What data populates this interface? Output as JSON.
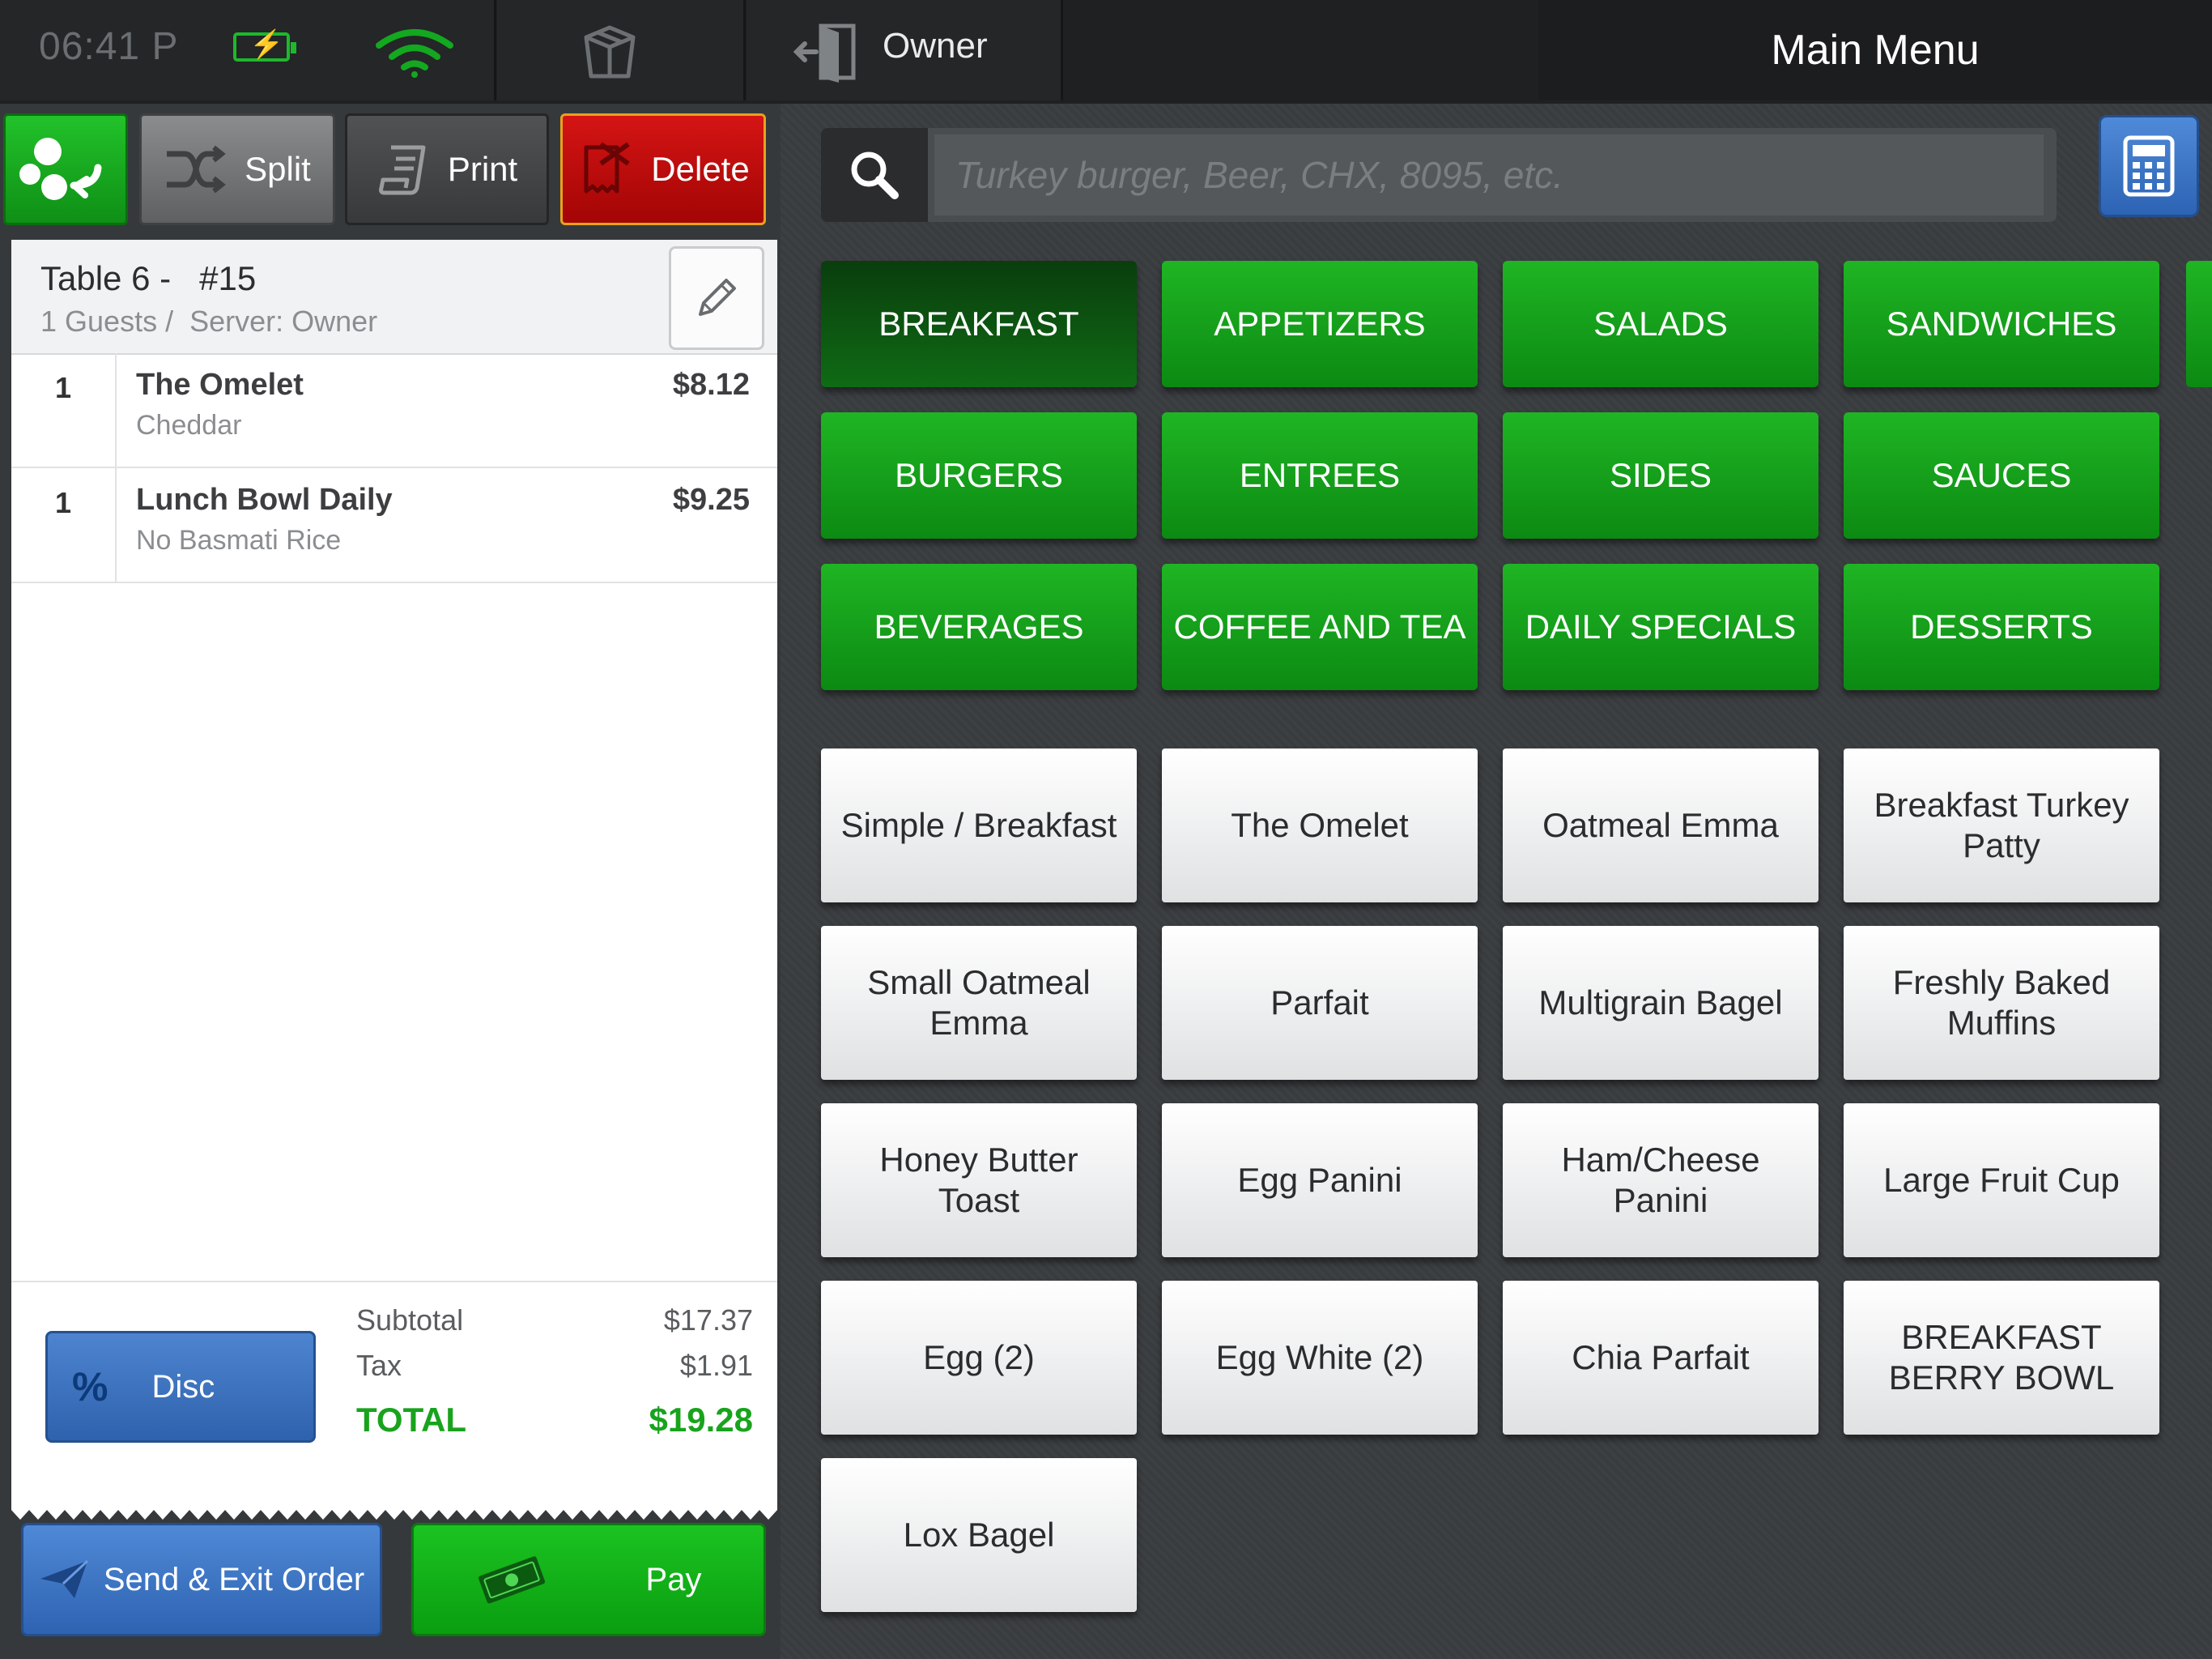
{
  "status_bar": {
    "time": "06:41 P",
    "user": "Owner",
    "title": "Main Menu"
  },
  "actions": {
    "split": "Split",
    "print": "Print",
    "delete": "Delete"
  },
  "ticket": {
    "table": "Table 6 -   #15",
    "subtitle": "1 Guests /  Server: Owner",
    "items": [
      {
        "qty": "1",
        "name": "The Omelet",
        "modifier": "Cheddar",
        "price": "$8.12"
      },
      {
        "qty": "1",
        "name": "Lunch Bowl Daily",
        "modifier": "No Basmati Rice",
        "price": "$9.25"
      }
    ],
    "subtotal_label": "Subtotal",
    "subtotal": "$17.37",
    "tax_label": "Tax",
    "tax": "$1.91",
    "total_label": "TOTAL",
    "total": "$19.28",
    "disc_symbol": "%",
    "disc_label": "Disc"
  },
  "bottom": {
    "send": "Send & Exit Order",
    "pay": "Pay"
  },
  "search": {
    "placeholder": "Turkey burger, Beer, CHX, 8095, etc."
  },
  "categories": [
    {
      "label": "BREAKFAST",
      "selected": true
    },
    {
      "label": "APPETIZERS"
    },
    {
      "label": "SALADS"
    },
    {
      "label": "SANDWICHES"
    },
    {
      "label": "BURGERS"
    },
    {
      "label": "ENTREES"
    },
    {
      "label": "SIDES"
    },
    {
      "label": "SAUCES"
    },
    {
      "label": "BEVERAGES"
    },
    {
      "label": "COFFEE AND TEA"
    },
    {
      "label": "DAILY SPECIALS"
    },
    {
      "label": "DESSERTS"
    }
  ],
  "items": [
    "Simple / Breakfast",
    "The Omelet",
    "Oatmeal Emma",
    "Breakfast Turkey Patty",
    "Small Oatmeal Emma",
    "Parfait",
    "Multigrain Bagel",
    "Freshly Baked Muffins",
    "Honey Butter Toast",
    "Egg Panini",
    "Ham/Cheese Panini",
    "Large Fruit Cup",
    "Egg (2)",
    "Egg White (2)",
    "Chia Parfait",
    "BREAKFAST BERRY BOWL",
    "Lox Bagel"
  ],
  "colors": {
    "category_green": "#1fb524",
    "selected_category": "#0a3d0d",
    "delete_red": "#d51414",
    "total_green": "#19a31d",
    "action_blue": "#2e63b2"
  }
}
